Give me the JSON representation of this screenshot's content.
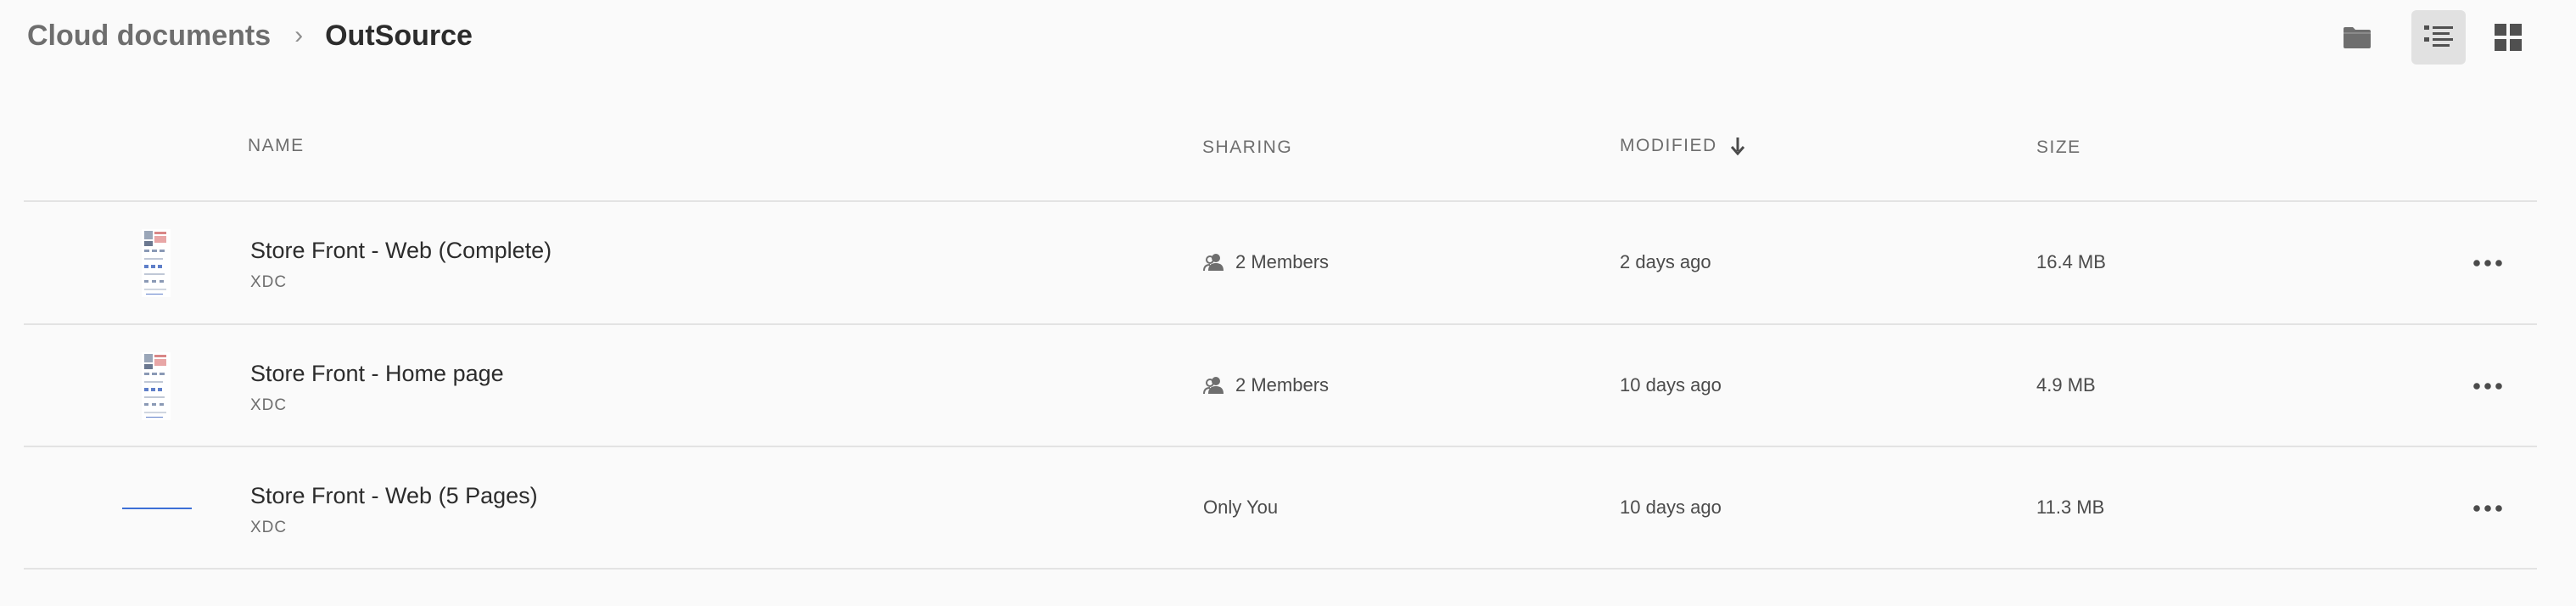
{
  "breadcrumb": {
    "root": "Cloud documents",
    "separator": "›",
    "current": "OutSource"
  },
  "toolbar": {
    "folder_icon": "folder-icon",
    "list_view_icon": "list-view-icon",
    "grid_view_icon": "grid-view-icon",
    "active_view": "list"
  },
  "columns": {
    "name": "NAME",
    "sharing": "SHARING",
    "modified": "MODIFIED",
    "size": "SIZE",
    "sort_icon": "arrow-down-icon"
  },
  "files": [
    {
      "name": "Store Front - Web (Complete)",
      "type": "XDC",
      "sharing": "2 Members",
      "sharing_icon": "people-icon",
      "modified": "2 days ago",
      "size": "16.4 MB",
      "thumbnail": "mockup-thumbnail"
    },
    {
      "name": "Store Front - Home page",
      "type": "XDC",
      "sharing": "2 Members",
      "sharing_icon": "people-icon",
      "modified": "10 days ago",
      "size": "4.9 MB",
      "thumbnail": "mockup-thumbnail"
    },
    {
      "name": "Store Front - Web (5 Pages)",
      "type": "XDC",
      "sharing": "Only You",
      "sharing_icon": "",
      "modified": "10 days ago",
      "size": "11.3 MB",
      "thumbnail": "line-thumbnail"
    }
  ],
  "colors": {
    "background": "#fafafa",
    "text_primary": "#2c2c2c",
    "text_secondary": "#6e6e6e",
    "divider": "#e3e3e3",
    "active_toggle": "#e1e1e1",
    "thumbnail_accent": "#3d6fd6"
  }
}
